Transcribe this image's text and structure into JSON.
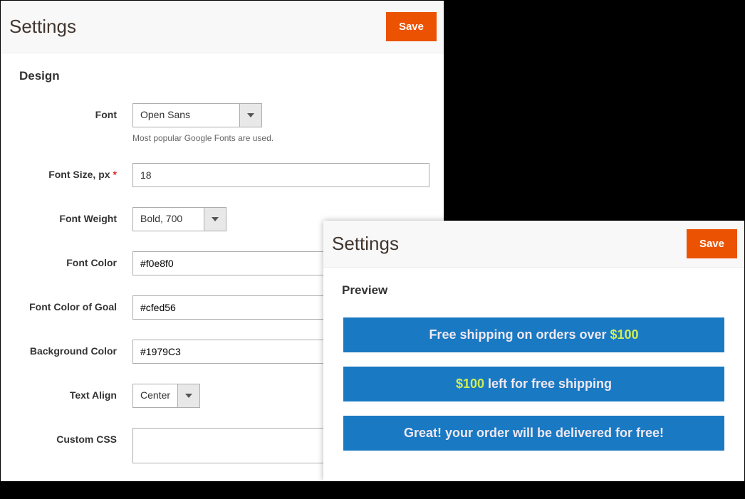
{
  "left": {
    "title": "Settings",
    "save": "Save",
    "section": "Design",
    "fields": {
      "font": {
        "label": "Font",
        "value": "Open Sans",
        "hint": "Most popular Google Fonts are used."
      },
      "fontSize": {
        "label": "Font Size, px",
        "value": "18"
      },
      "fontWeight": {
        "label": "Font Weight",
        "value": "Bold, 700"
      },
      "fontColor": {
        "label": "Font Color",
        "value": "#f0e8f0",
        "swatch": "#f0e8f0"
      },
      "goalColor": {
        "label": "Font Color of Goal",
        "value": "#cfed56",
        "swatch": "#cfed56"
      },
      "bgColor": {
        "label": "Background Color",
        "value": "#1979C3",
        "swatch": "#1979C3"
      },
      "textAlign": {
        "label": "Text Align",
        "value": "Center"
      },
      "customCss": {
        "label": "Custom CSS",
        "value": ""
      }
    }
  },
  "right": {
    "title": "Settings",
    "save": "Save",
    "section": "Preview",
    "bars": {
      "line1_a": "Free shipping on orders over ",
      "line1_goal": "$100",
      "line2_goal": "$100",
      "line2_b": " left for free shipping",
      "line3": "Great! your order will be delivered for free!"
    }
  }
}
